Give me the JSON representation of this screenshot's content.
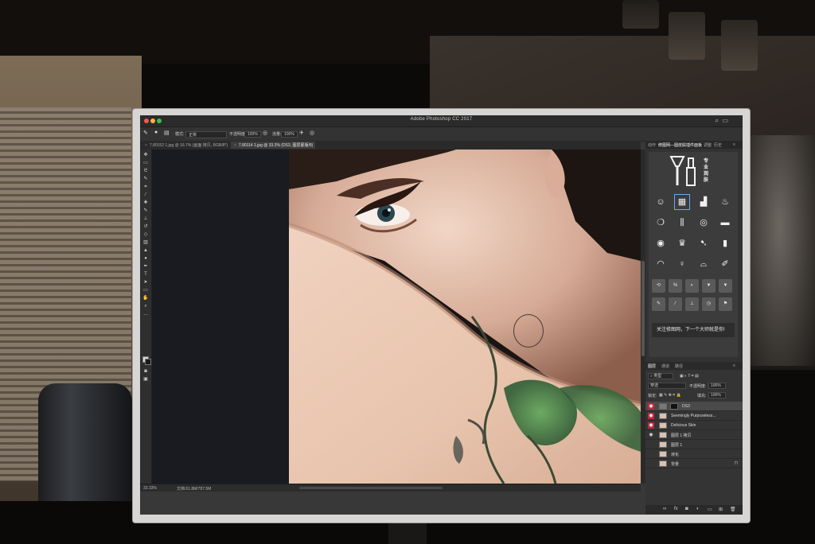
{
  "app": {
    "title": "Adobe Photoshop CC 2017",
    "search_icon": "search-icon",
    "panels_icon": "panels-icon"
  },
  "options_bar": {
    "mode_label": "模式:",
    "mode_value": "正常",
    "opacity_label": "不透明度:",
    "opacity_value": "100%",
    "flow_label": "流量:",
    "flow_value": "100%"
  },
  "document_tabs": [
    {
      "label": "7.80152 1.jpg @ 16.7% (画面 拷贝, RGB/8*)",
      "active": false
    },
    {
      "label": "7.80114 1.jpg @ 33.3% (DS3, 图层蒙版/8)",
      "active": true
    }
  ],
  "status_bar": {
    "zoom": "33.33%",
    "doc_info": "文档:61.8M/787.5M"
  },
  "right_panel": {
    "tabs": [
      "动作",
      "修图网—圆皮肤插件面板",
      "调整",
      "历史"
    ],
    "plugin": {
      "logo_text": [
        "专",
        "业",
        "润",
        "肤"
      ],
      "message": "关注修图网，下一个大师就是你!"
    }
  },
  "layers_panel": {
    "tabs": [
      "图层",
      "通道",
      "路径"
    ],
    "filter_label": "类型",
    "blend_mode": "穿透",
    "opacity_label": "不透明度:",
    "opacity_value": "100%",
    "lock_label": "锁定:",
    "fill_label": "填充:",
    "fill_value": "100%",
    "layers": [
      {
        "name": "DS3",
        "visible": true,
        "highlight": true,
        "active": true,
        "kind": "group"
      },
      {
        "name": "Seemingly Purposeless...",
        "visible": true,
        "highlight": true,
        "active": false,
        "kind": "image"
      },
      {
        "name": "Delicious Skin",
        "visible": true,
        "highlight": true,
        "active": false,
        "kind": "image"
      },
      {
        "name": "图层 1 拷贝",
        "visible": true,
        "highlight": false,
        "active": false,
        "kind": "image"
      },
      {
        "name": "图层 1",
        "visible": false,
        "highlight": false,
        "active": false,
        "kind": "image"
      },
      {
        "name": "液化",
        "visible": false,
        "highlight": false,
        "active": false,
        "kind": "image"
      },
      {
        "name": "背景",
        "visible": false,
        "highlight": false,
        "active": false,
        "kind": "image",
        "locked": true
      }
    ]
  },
  "colors": {
    "accent": "#b8283b",
    "panel_bg": "#323232",
    "canvas_bg": "#1a1b20"
  }
}
